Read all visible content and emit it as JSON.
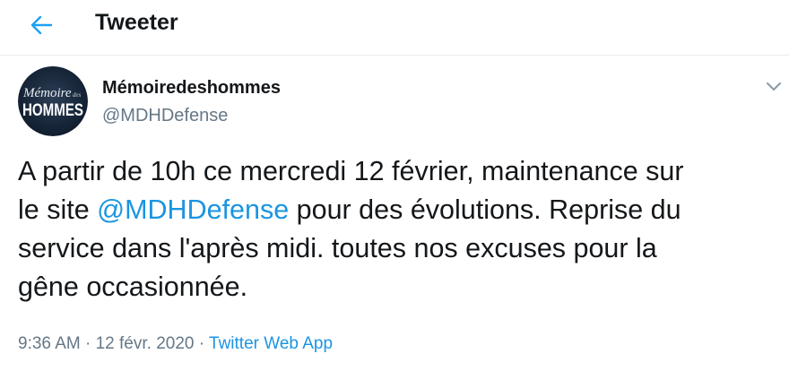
{
  "header": {
    "back_icon": "arrow-left-icon",
    "title": "Tweeter"
  },
  "author": {
    "avatar_icon": "profile-avatar",
    "avatar_text_top": "Mémoire",
    "avatar_text_small": "des",
    "avatar_text_bottom": "HOMMES",
    "name": "Mémoiredeshommes",
    "handle": "@MDHDefense"
  },
  "tweet": {
    "line1": "A partir de 10h ce mercredi 12 février, maintenance sur",
    "line2_before": "le site ",
    "line2_mention": "@MDHDefense",
    "line2_after": " pour des évolutions. Reprise du",
    "line3": "service dans l'après midi. toutes nos excuses pour la",
    "line4": "gêne occasionnée."
  },
  "meta": {
    "time": "9:36 AM",
    "separator1": " · ",
    "date": "12 févr. 2020",
    "separator2": " · ",
    "source": "Twitter Web App"
  },
  "menu": {
    "caret_icon": "chevron-down-icon"
  },
  "colors": {
    "accent": "#1b95e0",
    "muted": "#657786",
    "text": "#14171a",
    "divider": "#e6ecf0"
  }
}
